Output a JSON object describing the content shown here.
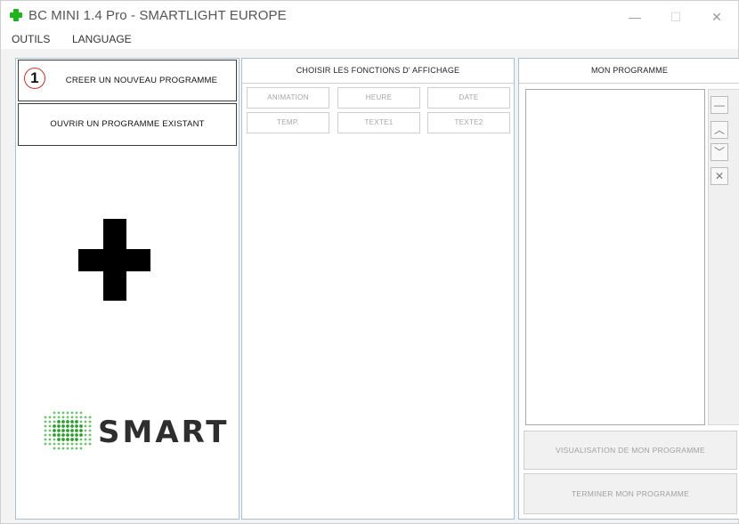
{
  "window": {
    "title": "BC MINI 1.4 Pro - SMARTLIGHT EUROPE",
    "minimize": "—",
    "maximize": "☐",
    "close": "✕"
  },
  "menu": {
    "items": [
      "OUTILS",
      "LANGUAGE"
    ]
  },
  "left_panel": {
    "new_program": {
      "step": "1",
      "label": "CREER UN NOUVEAU PROGRAMME"
    },
    "open_program": "OUVRIR UN PROGRAMME EXISTANT",
    "logo_text": "SMART"
  },
  "middle_panel": {
    "header": "CHOISIR LES FONCTIONS D' AFFICHAGE",
    "functions": [
      "ANIMATION",
      "HEURE",
      "DATE",
      "TEMP.",
      "TEXTE1",
      "TEXTE2"
    ]
  },
  "right_panel": {
    "header": "MON PROGRAMME",
    "side_buttons": {
      "remove": "—",
      "up": "︿",
      "down": "﹀",
      "delete": "✕"
    },
    "preview_button": "VISUALISATION DE MON PROGRAMME",
    "finish_button": "TERMINER MON PROGRAMME"
  },
  "colors": {
    "accent_green": "#1fb51f",
    "badge_ring": "#c0392b",
    "panel_border": "#a9c0d6",
    "disabled_text": "#a6a6a6"
  }
}
